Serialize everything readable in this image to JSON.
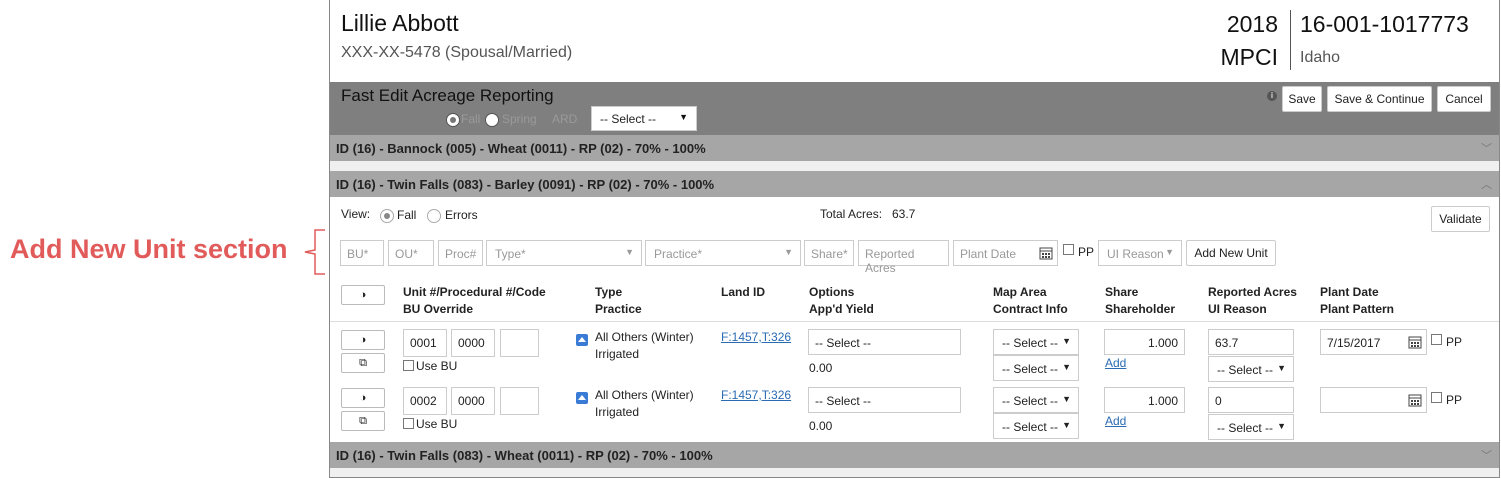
{
  "annotation": {
    "label": "Add New Unit section"
  },
  "header": {
    "name": "Lillie Abbott",
    "ssn": "XXX-XX-5478 (Spousal/Married)",
    "year": "2018",
    "plan": "MPCI",
    "policy": "16-001-1017773",
    "state": "Idaho"
  },
  "toolbar": {
    "title": "Fast Edit Acreage Reporting",
    "fall_label": "Fall",
    "spring_label": "Spring",
    "ard_label": "ARD",
    "ard_select": "-- Select --",
    "save": "Save",
    "save_continue": "Save & Continue",
    "cancel": "Cancel"
  },
  "groups": [
    {
      "title": "ID (16) - Bannock (005) - Wheat (0011) - RP (02) - 70% - 100%"
    },
    {
      "title": "ID (16) - Twin Falls (083) - Barley (0091) - RP (02) - 70% - 100%"
    },
    {
      "title": "ID (16) - Twin Falls (083) - Wheat (0011) - RP (02) - 70% - 100%"
    }
  ],
  "view": {
    "label": "View:",
    "fall": "Fall",
    "errors": "Errors",
    "total_label": "Total Acres:",
    "total_value": "63.7",
    "validate": "Validate"
  },
  "add_unit": {
    "bu": "BU*",
    "ou": "OU*",
    "proc": "Proc#",
    "type": "Type*",
    "practice": "Practice*",
    "share": "Share*",
    "reported_acres": "Reported Acres",
    "plant_date": "Plant Date",
    "pp": "PP",
    "ui_reason": "UI Reason",
    "add_button": "Add New Unit"
  },
  "table_headers": {
    "unit": "Unit #/Procedural #/Code",
    "bu_override": "BU Override",
    "type": "Type",
    "practice": "Practice",
    "land_id": "Land ID",
    "options": "Options",
    "appd_yield": "App'd Yield",
    "map_area": "Map Area",
    "contract_info": "Contract Info",
    "share": "Share",
    "shareholder": "Shareholder",
    "reported_acres": "Reported Acres",
    "ui_reason": "UI Reason",
    "plant_date": "Plant Date",
    "plant_pattern": "Plant Pattern"
  },
  "rows": [
    {
      "unit": "0001",
      "proc": "0000",
      "code": "",
      "use_bu": "Use BU",
      "type": "All Others (Winter)",
      "practice": "Irrigated",
      "land_id": "F:1457,T:326",
      "options": "-- Select --",
      "appd_yield": "0.00",
      "map_area": "-- Select --",
      "contract_info": "-- Select --",
      "share": "1.000",
      "add": "Add",
      "reported_acres": "63.7",
      "ui_reason": "-- Select --",
      "plant_date": "7/15/2017",
      "pp": "PP"
    },
    {
      "unit": "0002",
      "proc": "0000",
      "code": "",
      "use_bu": "Use BU",
      "type": "All Others (Winter)",
      "practice": "Irrigated",
      "land_id": "F:1457,T:326",
      "options": "-- Select --",
      "appd_yield": "0.00",
      "map_area": "-- Select --",
      "contract_info": "-- Select --",
      "share": "1.000",
      "add": "Add",
      "reported_acres": "0",
      "ui_reason": "-- Select --",
      "plant_date": "",
      "pp": "PP"
    }
  ]
}
